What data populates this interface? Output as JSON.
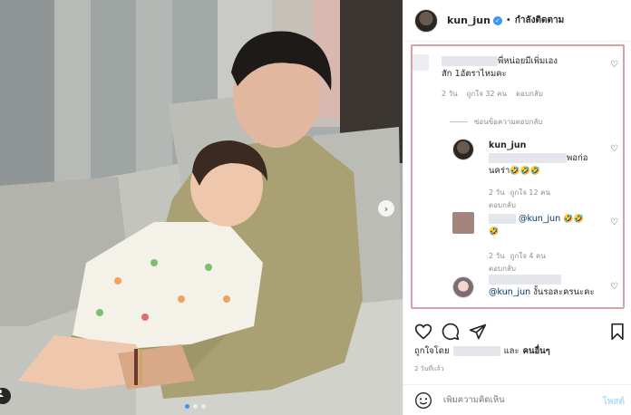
{
  "header": {
    "username": "kun_jun",
    "separator": "•",
    "follow_label": "กำลังติดตาม"
  },
  "comments": [
    {
      "text_line1": "พี่หน่อยมีเพิ่มเอง",
      "text_line2": "สัก 1อัตราไหมคะ",
      "time": "2 วัน",
      "likes": "ถูกใจ 32 คน",
      "reply": "ตอบกลับ"
    }
  ],
  "hide_replies_label": "ซ่อนข้อความตอบกลับ",
  "replies": [
    {
      "username": "kun_jun",
      "text_end": "พอก่อ",
      "text_line2": "นคร่า",
      "emoji": "🤣🤣🤣",
      "time": "2 วัน",
      "likes": "ถูกใจ 12 คน",
      "reply": "ตอบกลับ"
    },
    {
      "mention": "@kun_jun",
      "emoji_line1": "🤣🤣",
      "emoji_line2": "🤣",
      "time": "2 วัน",
      "likes": "ถูกใจ 4 คน",
      "reply": "ตอบกลับ"
    },
    {
      "mention": "@kun_jun",
      "text": "งั้นรอละครนะคะ"
    }
  ],
  "likes_line": {
    "prefix": "ถูกใจโดย",
    "middle": "และ",
    "others": "คนอื่นๆ"
  },
  "post_time": "2 วันที่แล้ว",
  "composer": {
    "placeholder": "เพิ่มความคิดเห็น",
    "post_label": "โพสต์"
  },
  "icons": {
    "like": "heart-icon",
    "comment": "comment-icon",
    "share": "share-icon",
    "save": "bookmark-icon",
    "emoji": "smiley-icon"
  },
  "colors": {
    "verified": "#3897f0",
    "highlight_box": "#d9a1a6",
    "post_button_disabled": "#b2dffc",
    "muted_text": "#8e8e8e"
  }
}
